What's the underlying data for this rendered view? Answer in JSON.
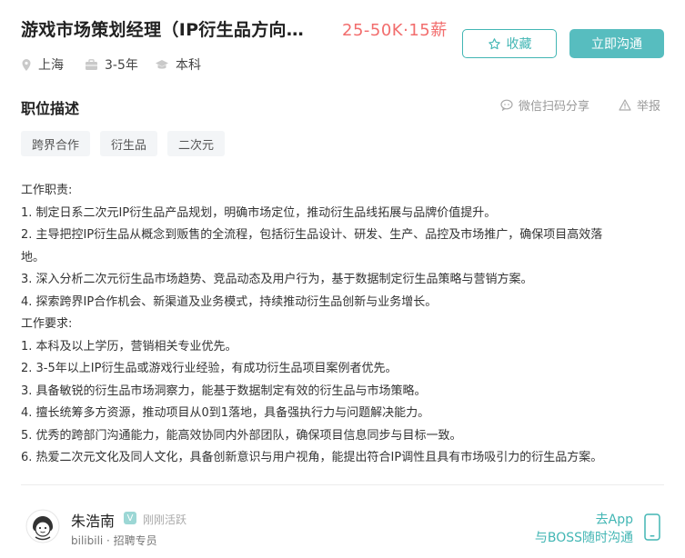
{
  "job": {
    "title": "游戏市场策划经理（IP衍生品方向…",
    "salary": "25-50K·15薪",
    "favorite_label": "收藏",
    "chat_label": "立即沟通",
    "location": "上海",
    "experience": "3-5年",
    "education": "本科"
  },
  "section": {
    "title": "职位描述",
    "share_label": "微信扫码分享",
    "report_label": "举报"
  },
  "tags": [
    "跨界合作",
    "衍生品",
    "二次元"
  ],
  "description": [
    "工作职责:",
    "1. 制定日系二次元IP衍生品产品规划，明确市场定位，推动衍生品线拓展与品牌价值提升。",
    "2. 主导把控IP衍生品从概念到贩售的全流程，包括衍生品设计、研发、生产、品控及市场推广，确保项目高效落",
    "地。",
    "3. 深入分析二次元衍生品市场趋势、竞品动态及用户行为，基于数据制定衍生品策略与营销方案。",
    "4. 探索跨界IP合作机会、新渠道及业务模式，持续推动衍生品创新与业务增长。",
    "工作要求:",
    "1. 本科及以上学历，营销相关专业优先。",
    "2. 3-5年以上IP衍生品或游戏行业经验，有成功衍生品项目案例者优先。",
    "3. 具备敏锐的衍生品市场洞察力，能基于数据制定有效的衍生品与市场策略。",
    "4. 擅长统筹多方资源，推动项目从0到1落地，具备强执行力与问题解决能力。",
    "5. 优秀的跨部门沟通能力，能高效协同内外部团队，确保项目信息同步与目标一致。",
    "6. 热爱二次元文化及同人文化，具备创新意识与用户视角，能提出符合IP调性且具有市场吸引力的衍生品方案。"
  ],
  "recruiter": {
    "name": "朱浩南",
    "verified_badge": "V",
    "status": "刚刚活跃",
    "company": "bilibili · 招聘专员"
  },
  "app_prompt": {
    "line1": "去App",
    "line2": "与BOSS随时沟通"
  },
  "colors": {
    "accent": "#42b6b4",
    "accent_fill": "#57bdbf",
    "salary": "#f26d6d"
  },
  "icons": [
    "location-icon",
    "briefcase-icon",
    "graduation-cap-icon",
    "star-icon",
    "wechat-icon",
    "warning-icon",
    "phone-icon"
  ]
}
